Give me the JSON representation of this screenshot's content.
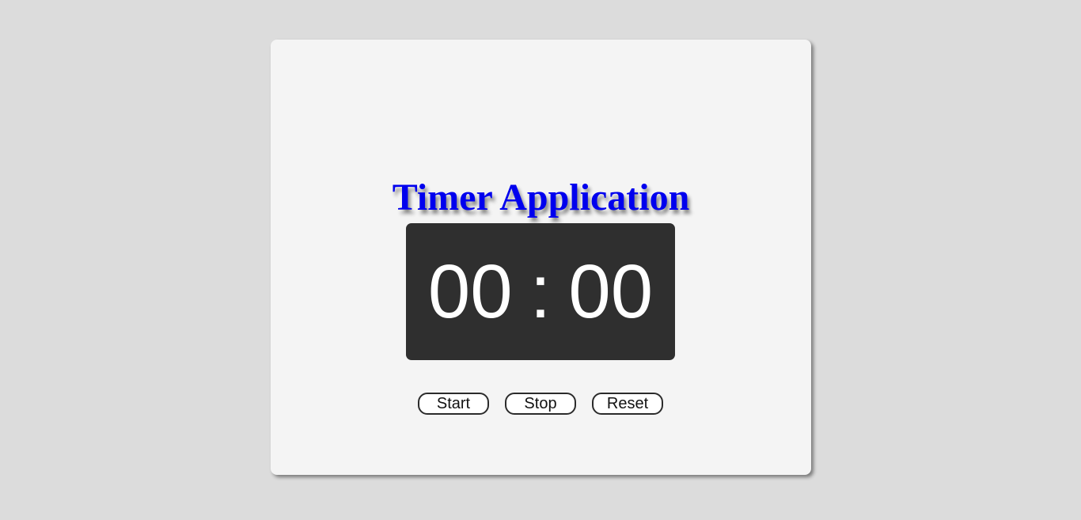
{
  "app": {
    "title": "Timer Application"
  },
  "timer": {
    "minutes": "00",
    "separator": ":",
    "seconds": "00"
  },
  "controls": {
    "start_label": "Start",
    "stop_label": "Stop",
    "reset_label": "Reset"
  },
  "colors": {
    "page_background": "#dcdcdc",
    "card_background": "#f4f4f4",
    "title_color": "#0000ee",
    "display_background": "#2f2f2f",
    "display_text": "#ffffff"
  }
}
